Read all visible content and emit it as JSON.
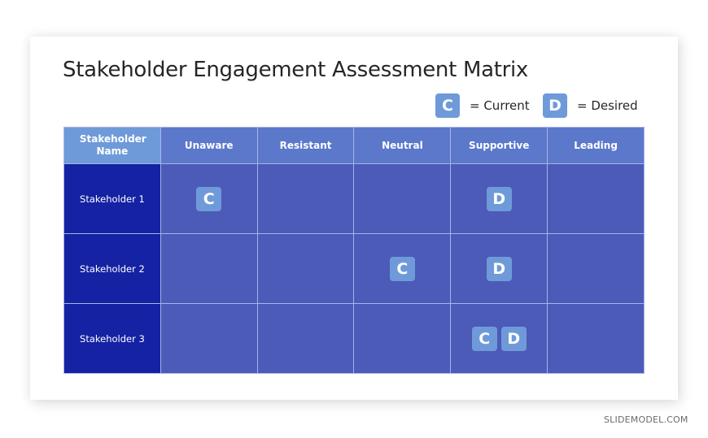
{
  "slide": {
    "title": "Stakeholder Engagement Assessment Matrix",
    "legend": [
      {
        "badge": "C",
        "label": "= Current"
      },
      {
        "badge": "D",
        "label": "= Desired"
      }
    ]
  },
  "matrix": {
    "header": {
      "name_col": "Stakeholder Name",
      "levels": [
        "Unaware",
        "Resistant",
        "Neutral",
        "Supportive",
        "Leading"
      ]
    },
    "rows": [
      {
        "name": "Stakeholder 1",
        "cells": [
          [
            "C"
          ],
          [],
          [],
          [
            "D"
          ],
          []
        ]
      },
      {
        "name": "Stakeholder 2",
        "cells": [
          [],
          [],
          [
            "C"
          ],
          [
            "D"
          ],
          []
        ]
      },
      {
        "name": "Stakeholder 3",
        "cells": [
          [],
          [],
          [],
          [
            "C",
            "D"
          ],
          []
        ]
      }
    ]
  },
  "colors": {
    "badge": "#6f9ad9",
    "header": "#5b78cb",
    "name_header": "#6f9ad9",
    "name_cell": "#1522a3",
    "body_cell": "#4c5ab8"
  },
  "footer": {
    "brand": "SLIDEMODEL.COM"
  }
}
